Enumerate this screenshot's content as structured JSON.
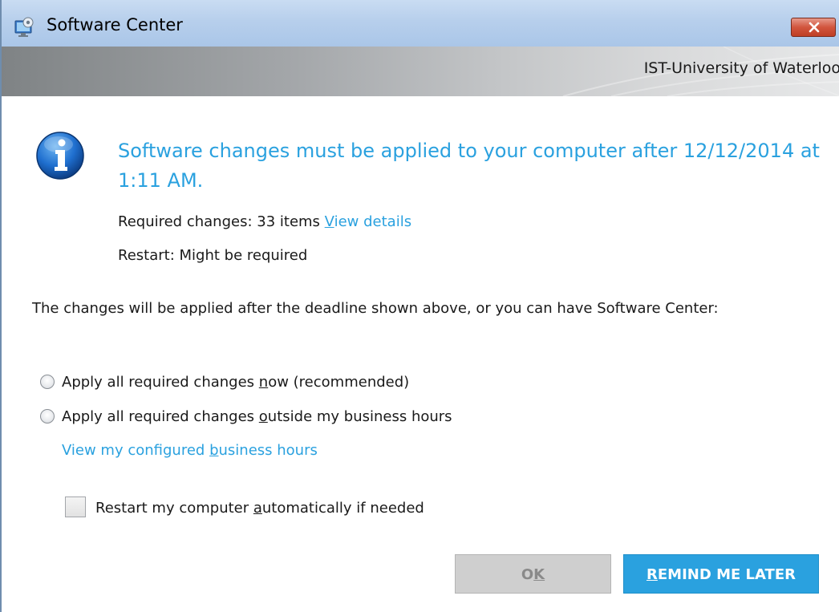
{
  "window": {
    "title": "Software Center",
    "organization": "IST-University of Waterloo",
    "app_icon": "software-center-icon",
    "close_icon": "close-icon"
  },
  "message": {
    "icon": "info-icon",
    "headline": "Software changes must be applied to your computer after 12/12/2014 at 1:11 AM.",
    "required_label": "Required changes:",
    "required_value": "33 items",
    "view_details_label": "View details",
    "restart_label": "Restart:",
    "restart_value": "Might be required"
  },
  "description": "The changes will be applied after the deadline shown above, or you can have Software Center:",
  "options": [
    {
      "label": "Apply all required changes now (recommended)",
      "selected": false
    },
    {
      "label": "Apply all required changes outside my business hours",
      "selected": false
    }
  ],
  "business_hours_link": "View my configured business hours",
  "restart_checkbox": {
    "label": "Restart my computer automatically if needed",
    "checked": false
  },
  "buttons": {
    "ok": "OK",
    "remind": "REMIND ME LATER"
  },
  "colors": {
    "accent": "#2aa1df",
    "disabled": "#cfcfcf"
  }
}
